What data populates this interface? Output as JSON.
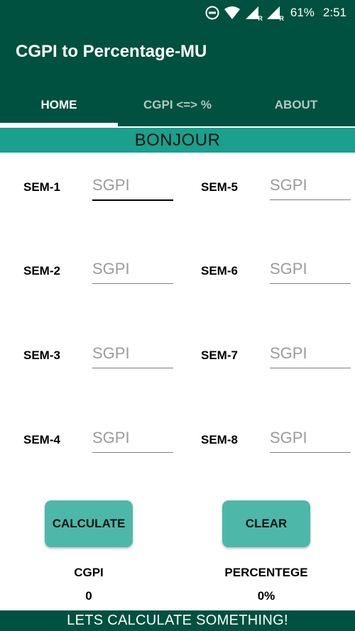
{
  "status_bar": {
    "battery": "61%",
    "time": "2:51",
    "icons": [
      "do-not-disturb-icon",
      "wifi-icon",
      "signal-r-icon",
      "signal-r-icon"
    ],
    "roaming_glyph": "R"
  },
  "app": {
    "title": "CGPI to Percentage-MU"
  },
  "tabs": [
    {
      "label": "HOME",
      "active": true
    },
    {
      "label": "CGPI <=> %",
      "active": false
    },
    {
      "label": "ABOUT",
      "active": false
    }
  ],
  "banner": "BONJOUR",
  "semesters": [
    {
      "label": "SEM-1",
      "placeholder": "SGPI"
    },
    {
      "label": "SEM-2",
      "placeholder": "SGPI"
    },
    {
      "label": "SEM-3",
      "placeholder": "SGPI"
    },
    {
      "label": "SEM-4",
      "placeholder": "SGPI"
    },
    {
      "label": "SEM-5",
      "placeholder": "SGPI"
    },
    {
      "label": "SEM-6",
      "placeholder": "SGPI"
    },
    {
      "label": "SEM-7",
      "placeholder": "SGPI"
    },
    {
      "label": "SEM-8",
      "placeholder": "SGPI"
    }
  ],
  "buttons": {
    "calculate": "CALCULATE",
    "clear": "CLEAR"
  },
  "results": {
    "cgpi_label": "CGPI",
    "cgpi_value": "0",
    "percentage_label": "PERCENTEGE",
    "percentage_value": "0%"
  },
  "footer": "LETS CALCULATE SOMETHING!",
  "colors": {
    "primary_dark": "#00513f",
    "banner": "#1aa08d",
    "button": "#4db8a9"
  }
}
